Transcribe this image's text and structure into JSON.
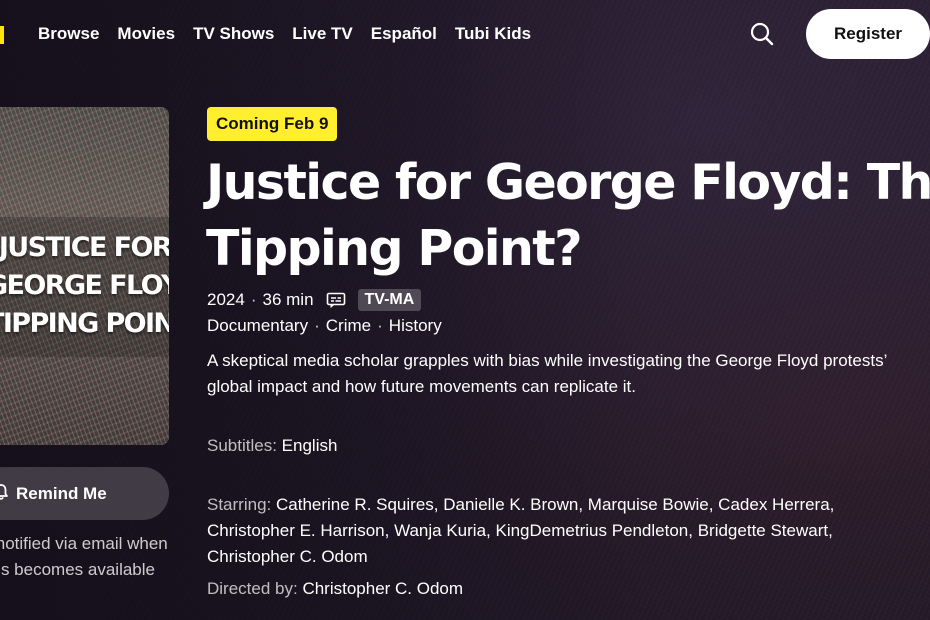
{
  "nav": {
    "links": [
      "Browse",
      "Movies",
      "TV Shows",
      "Live TV",
      "Español",
      "Tubi Kids"
    ],
    "search_icon": "search-icon",
    "register_label": "Register"
  },
  "poster": {
    "title": "JUSTICE FOR\nGEORGE FLOYD:\nTIPPING POINT?"
  },
  "remind": {
    "label": "Remind Me",
    "icon": "bell-icon",
    "note": "Be notified via email when this becomes available"
  },
  "details": {
    "badge": "Coming Feb 9",
    "title_line1": "Justice for George Floyd: The",
    "title_line2": "Tipping Point?",
    "year": "2024",
    "duration": "36 min",
    "rating": "TV-MA",
    "genres": [
      "Documentary",
      "Crime",
      "History"
    ],
    "description": "A skeptical media scholar grapples with bias while investigating the George Floyd protests’ global impact and how future movements can replicate it.",
    "subtitles_label": "Subtitles:",
    "subtitles_value": "English",
    "starring_label": "Starring:",
    "starring_value": "Catherine R. Squires, Danielle K. Brown, Marquise Bowie, Cadex Herrera, Christopher E. Harrison, Wanja Kuria, KingDemetrius Pendleton, Bridgette Stewart, Christopher C. Odom",
    "directed_label": "Directed by:",
    "directed_value": "Christopher C. Odom"
  },
  "colors": {
    "badge_bg": "#ffef2e",
    "logo_accent": "#ffe600",
    "register_bg": "#ffffff"
  }
}
